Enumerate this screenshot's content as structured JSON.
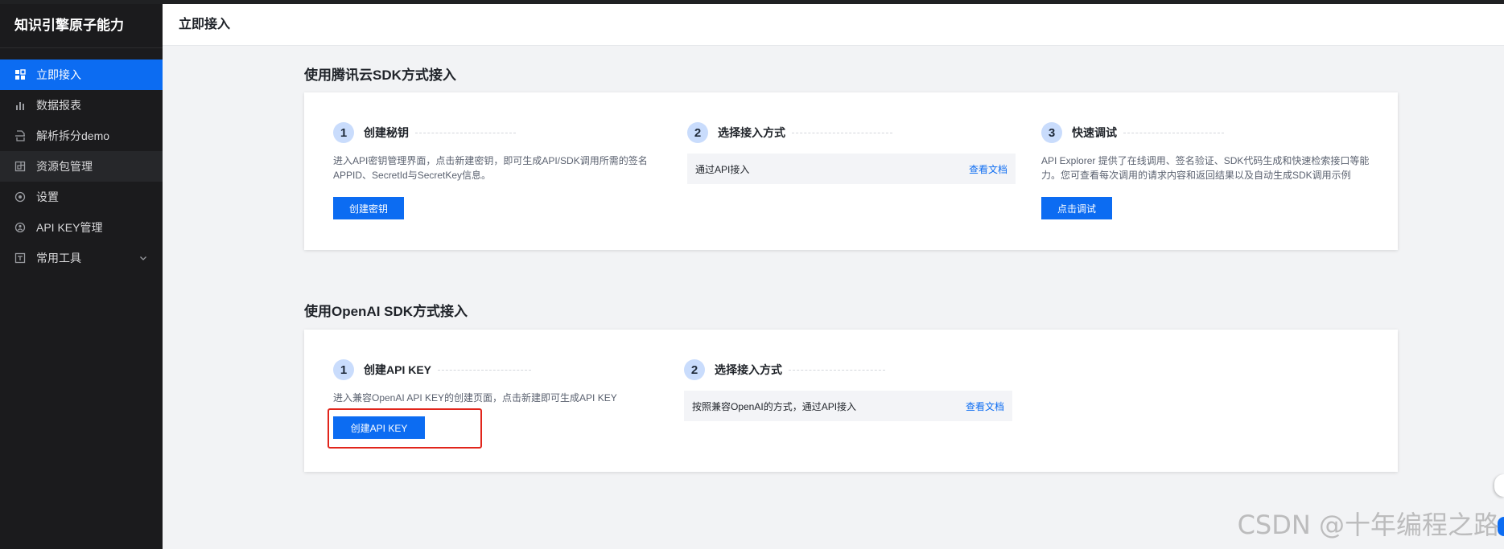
{
  "sidebar": {
    "brand": "知识引擎原子能力",
    "items": [
      {
        "label": "立即接入",
        "icon": "grid-icon",
        "active": true
      },
      {
        "label": "数据报表",
        "icon": "bar-chart-icon"
      },
      {
        "label": "解析拆分demo",
        "icon": "document-split-icon"
      },
      {
        "label": "资源包管理",
        "icon": "package-icon",
        "hover": true
      },
      {
        "label": "设置",
        "icon": "settings-icon"
      },
      {
        "label": "API KEY管理",
        "icon": "key-user-icon"
      },
      {
        "label": "常用工具",
        "icon": "toolbox-icon",
        "expandable": true
      }
    ]
  },
  "header": {
    "title": "立即接入"
  },
  "tencent_sdk": {
    "title": "使用腾讯云SDK方式接入",
    "steps": [
      {
        "num": "1",
        "title": "创建秘钥",
        "desc": "进入API密钥管理界面，点击新建密钥，即可生成API/SDK调用所需的签名APPID、SecretId与SecretKey信息。",
        "button": "创建密钥"
      },
      {
        "num": "2",
        "title": "选择接入方式",
        "method": "通过API接入",
        "doc_link": "查看文档"
      },
      {
        "num": "3",
        "title": "快速调试",
        "desc": "API Explorer 提供了在线调用、签名验证、SDK代码生成和快速检索接口等能力。您可查看每次调用的请求内容和返回结果以及自动生成SDK调用示例",
        "button": "点击调试"
      }
    ]
  },
  "openai_sdk": {
    "title": "使用OpenAI SDK方式接入",
    "steps": [
      {
        "num": "1",
        "title": "创建API KEY",
        "desc": "进入兼容OpenAI API KEY的创建页面，点击新建即可生成API KEY",
        "button": "创建API KEY"
      },
      {
        "num": "2",
        "title": "选择接入方式",
        "method": "按照兼容OpenAI的方式，通过API接入",
        "doc_link": "查看文档"
      }
    ]
  },
  "watermark": "CSDN @十年编程之路",
  "colors": {
    "primary": "#0c6cf2",
    "sidebar_bg": "#1b1b1d",
    "highlight": "#e1251b"
  }
}
